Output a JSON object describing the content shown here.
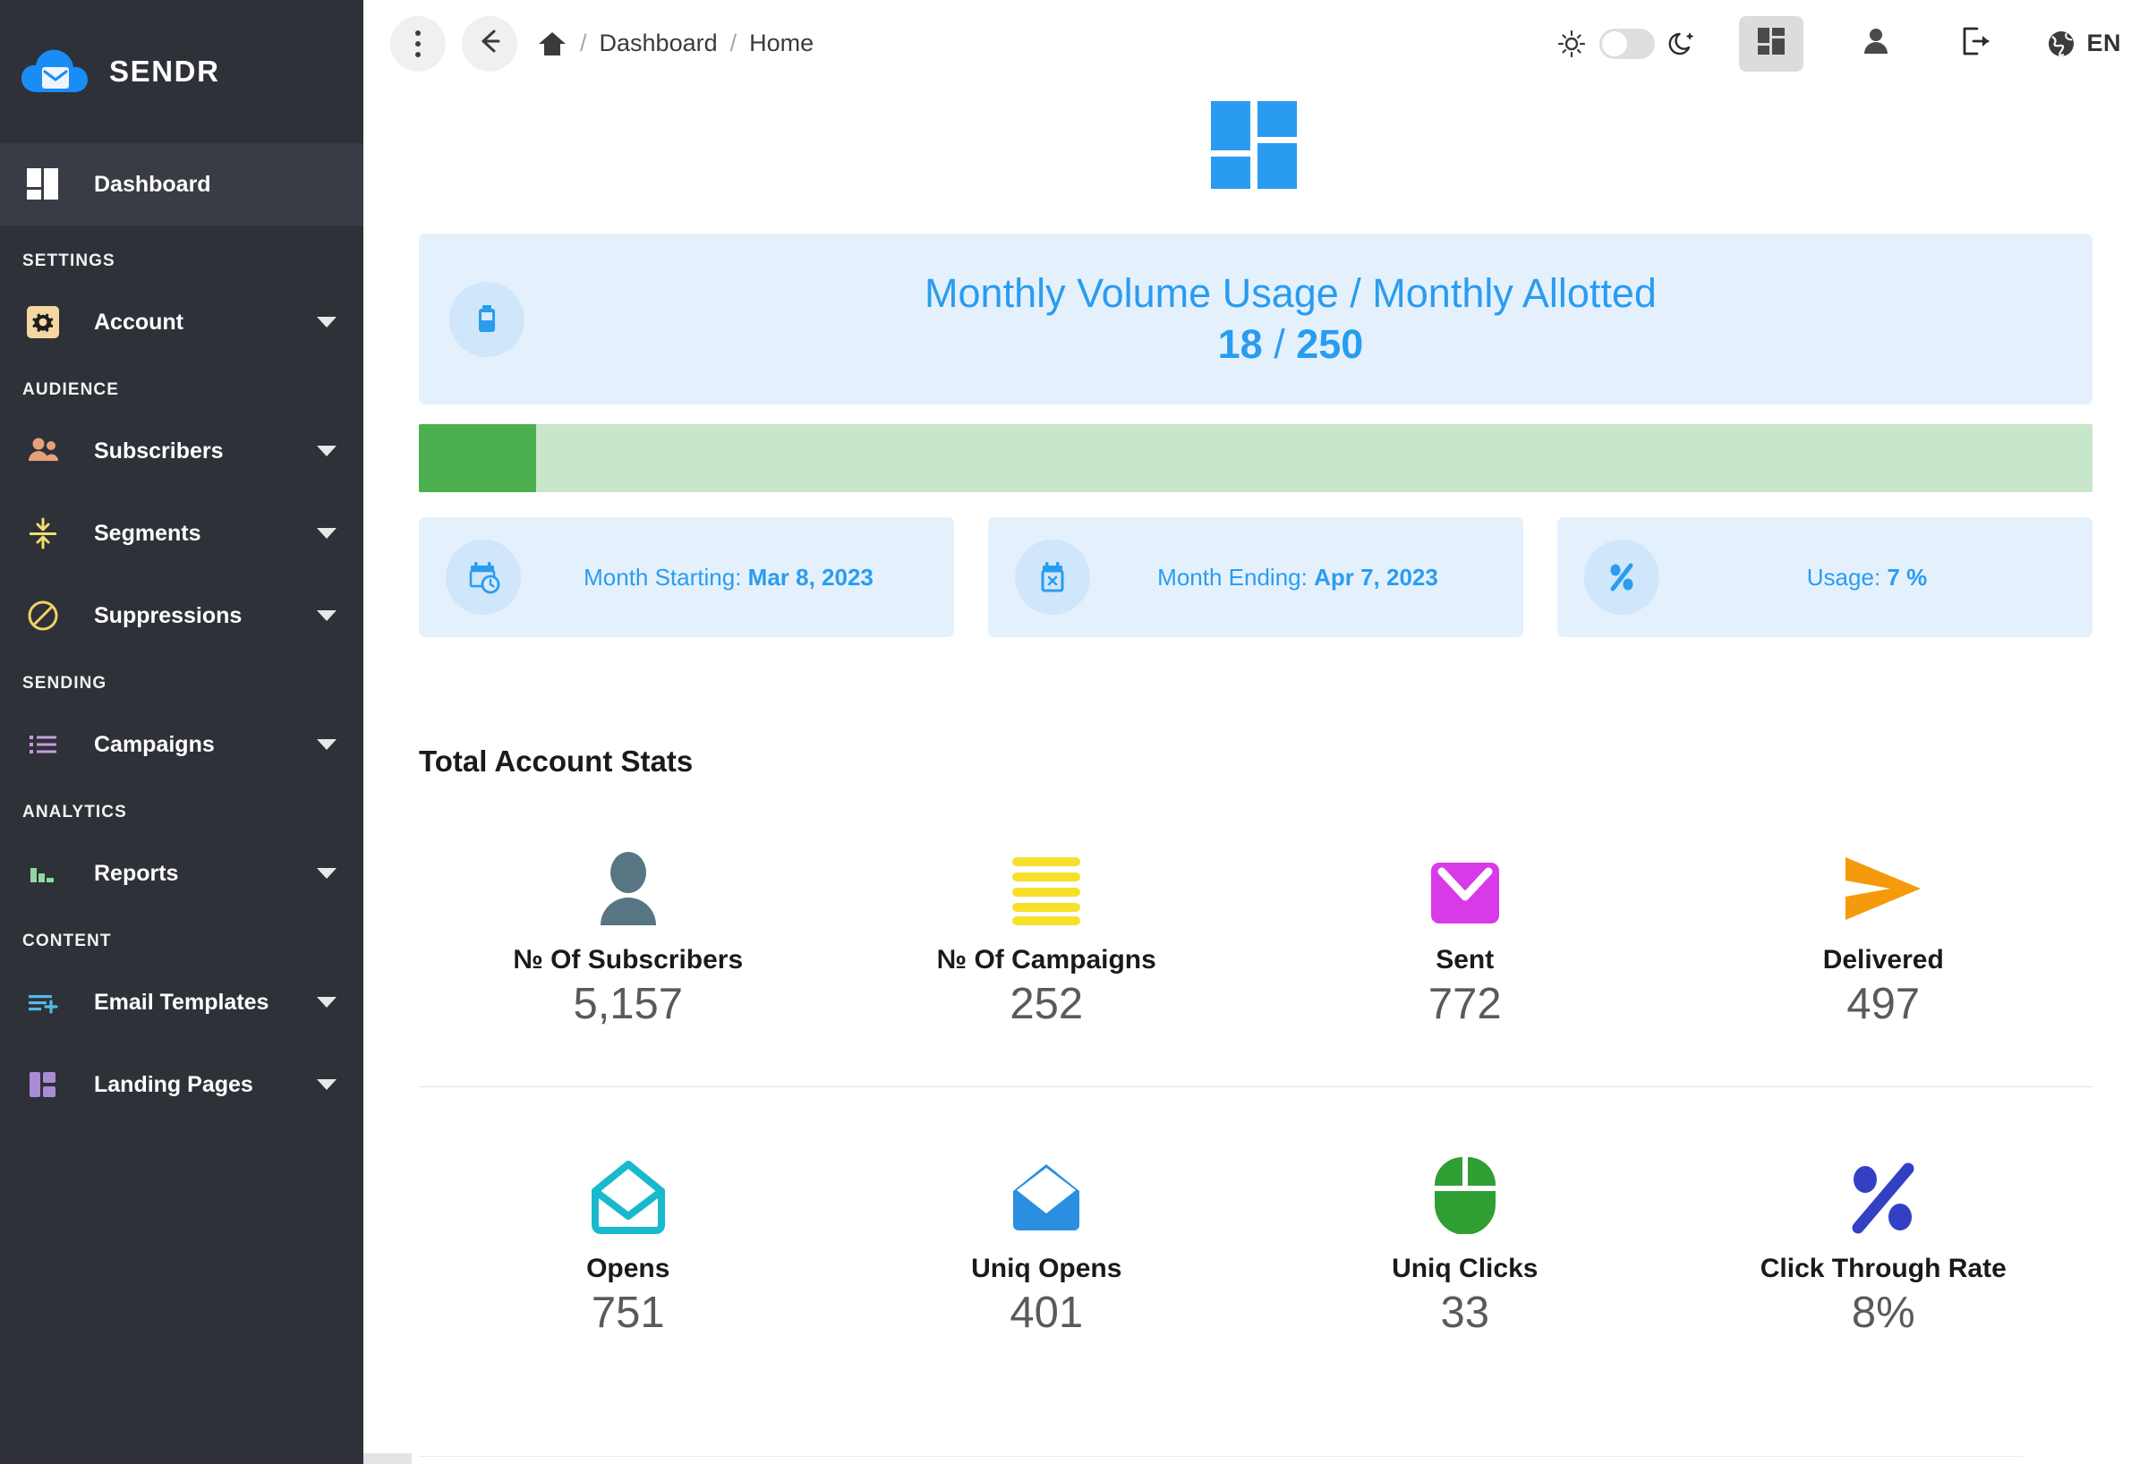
{
  "brand": {
    "name": "SENDR",
    "logo_icon": "cloud-mail-icon"
  },
  "sidebar": {
    "dashboard": {
      "label": "Dashboard",
      "icon": "grid-dashboard-icon"
    },
    "sections": [
      {
        "label": "SETTINGS",
        "items": [
          {
            "label": "Account",
            "icon": "gear-icon",
            "color": "#f5d7a1"
          }
        ]
      },
      {
        "label": "AUDIENCE",
        "items": [
          {
            "label": "Subscribers",
            "icon": "people-icon",
            "color": "#e8a07a"
          },
          {
            "label": "Segments",
            "icon": "segments-arrows-icon",
            "color": "#f2dd6e"
          },
          {
            "label": "Suppressions",
            "icon": "block-circle-icon",
            "color": "#f1d263"
          }
        ]
      },
      {
        "label": "SENDING",
        "items": [
          {
            "label": "Campaigns",
            "icon": "list-bullets-icon",
            "color": "#c69ce0"
          }
        ]
      },
      {
        "label": "ANALYTICS",
        "items": [
          {
            "label": "Reports",
            "icon": "bar-chart-icon",
            "color": "#90d6a0"
          }
        ]
      },
      {
        "label": "CONTENT",
        "items": [
          {
            "label": "Email Templates",
            "icon": "template-add-icon",
            "color": "#53b9e8"
          },
          {
            "label": "Landing Pages",
            "icon": "landing-page-icon",
            "color": "#a98bd6"
          }
        ]
      }
    ]
  },
  "topbar": {
    "menu_icon": "kebab-menu-icon",
    "back_icon": "arrow-left-icon",
    "home_icon": "home-icon",
    "breadcrumb": [
      "Dashboard",
      "Home"
    ],
    "breadcrumb_separator": "/",
    "light_icon": "sun-icon",
    "dark_icon": "moon-star-icon",
    "theme_toggle_state": "off",
    "apps_icon": "grid-apps-icon",
    "profile_icon": "person-icon",
    "logout_icon": "logout-icon",
    "globe_icon": "globe-icon",
    "language": "EN"
  },
  "hero": {
    "logo_icon": "grid-logo-icon"
  },
  "usage": {
    "icon": "battery-icon",
    "title": "Monthly Volume Usage / Monthly Allotted",
    "used": "18",
    "separator": "/",
    "allotted": "250",
    "progress_percent": 7,
    "progress_fill_color": "#4caf50",
    "progress_track_color": "#c8e6c9",
    "accent_color": "#2a9cf0"
  },
  "info_cards": [
    {
      "icon": "calendar-clock-icon",
      "label": "Month Starting:",
      "value": "Mar 8, 2023"
    },
    {
      "icon": "calendar-x-icon",
      "label": "Month Ending:",
      "value": "Apr 7, 2023"
    },
    {
      "icon": "percent-icon",
      "label": "Usage:",
      "value": "7 %"
    }
  ],
  "stats": {
    "title": "Total Account Stats",
    "row1": [
      {
        "icon": "person-icon",
        "color": "#577583",
        "label": "№ Of Subscribers",
        "value": "5,157"
      },
      {
        "icon": "campaign-lines-icon",
        "color": "#f7e029",
        "label": "№ Of Campaigns",
        "value": "252"
      },
      {
        "icon": "envelope-sent-icon",
        "color": "#d83ae8",
        "label": "Sent",
        "value": "772"
      },
      {
        "icon": "paper-plane-icon",
        "color": "#f59b0b",
        "label": "Delivered",
        "value": "497"
      }
    ],
    "row2": [
      {
        "icon": "envelope-open-icon",
        "color": "#18b9cc",
        "label": "Opens",
        "value": "751"
      },
      {
        "icon": "envelope-open-filled-icon",
        "color": "#2a8fe0",
        "label": "Uniq Opens",
        "value": "401"
      },
      {
        "icon": "mouse-icon",
        "color": "#2f9e33",
        "label": "Uniq Clicks",
        "value": "33"
      },
      {
        "icon": "percent-bold-icon",
        "color": "#3340c4",
        "label": "Click Through Rate",
        "value": "8%"
      }
    ]
  }
}
